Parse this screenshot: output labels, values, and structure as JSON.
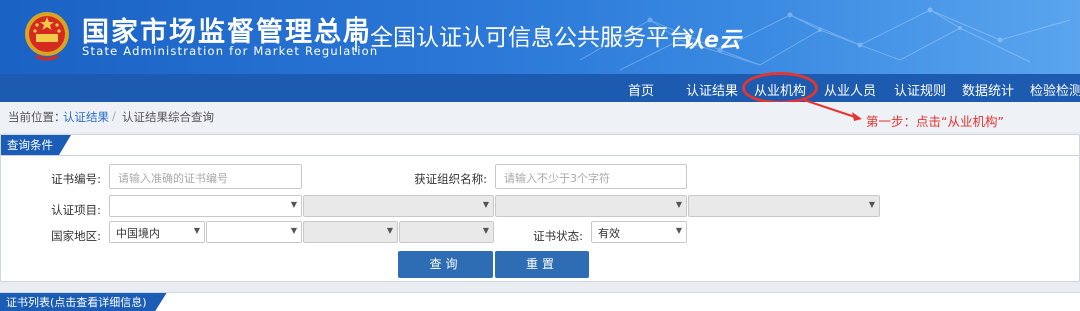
{
  "header": {
    "org_name_cn": "国家市场监督管理总局",
    "org_name_en": "State Administration  for  Market Regulation",
    "platform_title": "全国认证认可信息公共服务平台",
    "platform_logo_text": "认e云"
  },
  "nav": {
    "items": [
      "首页",
      "认证结果",
      "从业机构",
      "从业人员",
      "认证规则",
      "数据统计",
      "检验检测"
    ],
    "highlighted": "从业机构"
  },
  "breadcrumb": {
    "prefix": "当前位置：",
    "link": "认证结果",
    "separator": "/",
    "current": "认证结果综合查询"
  },
  "annotation": {
    "text": "第一步：点击“从业机构”",
    "color": "#e53530"
  },
  "query": {
    "panel_title": "查询条件",
    "cert_no_label": "证书编号:",
    "cert_no_placeholder": "请输入准确的证书编号",
    "org_name_label": "获证组织名称:",
    "org_name_placeholder": "请输入不少于3个字符",
    "project_label": "认证项目:",
    "region_label": "国家地区:",
    "region_value": "中国境内",
    "status_label": "证书状态:",
    "status_value": "有效",
    "search_button": "查询",
    "reset_button": "重置"
  },
  "list": {
    "title": "证书列表(点击查看详细信息)"
  },
  "colors": {
    "nav_bg": "#1c5bb0",
    "accent": "#1a5cb6",
    "button": "#2e6db4"
  }
}
